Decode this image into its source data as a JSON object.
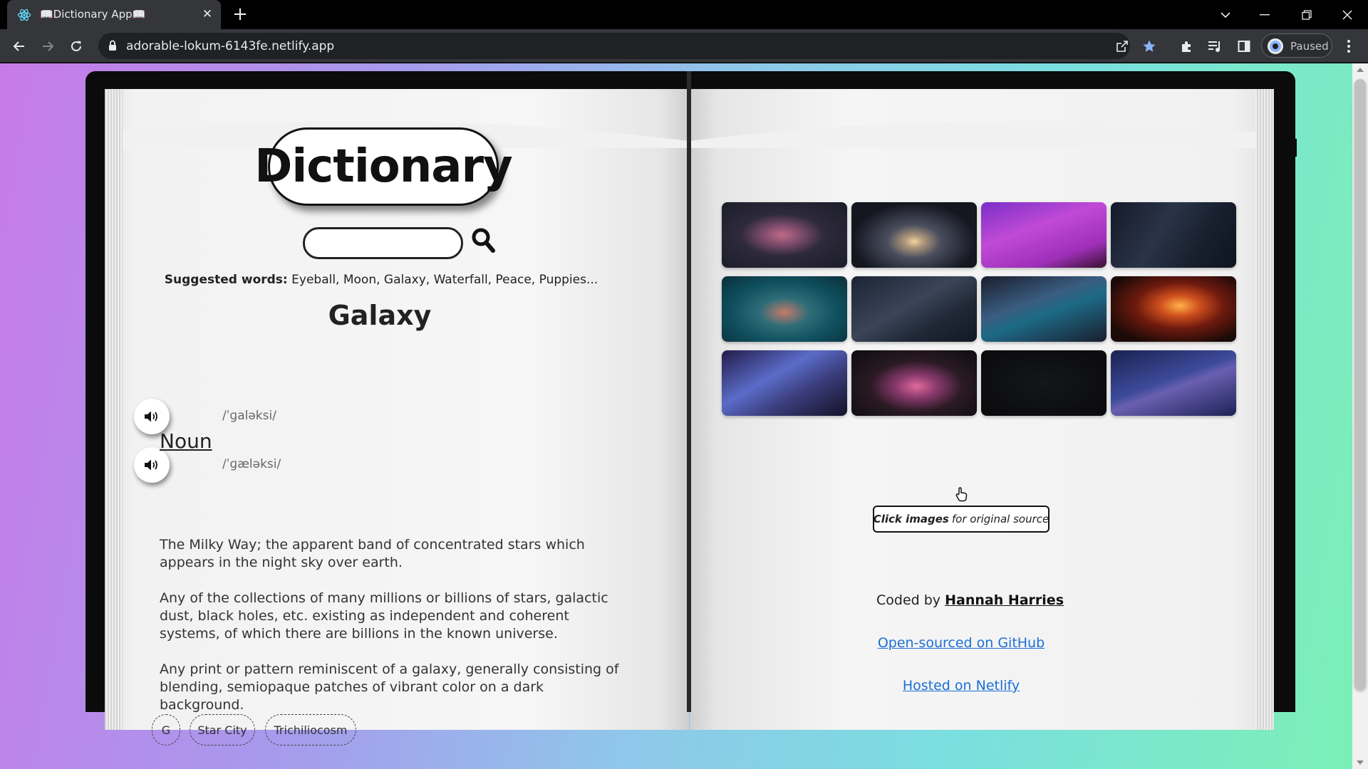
{
  "browser": {
    "tab_title": "📖Dictionary App📖",
    "url": "adorable-lokum-6143fe.netlify.app",
    "profile_status": "Paused"
  },
  "header": {
    "title": "Dictionary",
    "search": {
      "value": "",
      "placeholder": ""
    },
    "suggest_label": "Suggested words:",
    "suggest_words": "Eyeball, Moon, Galaxy, Waterfall, Peace, Puppies..."
  },
  "entry": {
    "word": "Galaxy",
    "phonetics": [
      "/ˈɡaləksi/",
      "/ˈɡæləksi/"
    ],
    "part_of_speech": "Noun",
    "definitions": [
      "The Milky Way; the apparent band of concentrated stars which appears in the night sky over earth.",
      "Any of the collections of many millions or billions of stars, galactic dust, black holes, etc. existing as independent and coherent systems, of which there are billions in the known universe.",
      "Any print or pattern reminiscent of a galaxy, generally consisting of blending, semiopaque patches of vibrant color on a dark background."
    ],
    "synonyms": [
      "G",
      "Star City",
      "Trichiliocosm"
    ]
  },
  "gallery": {
    "hint_bold": "Click images",
    "hint_rest": "for original source"
  },
  "footer": {
    "coded_by": "Coded by",
    "author": "Hannah Harries",
    "github": "Open-sourced on GitHub",
    "netlify": "Hosted on Netlify"
  },
  "colors": {
    "link": "#1a6fd6",
    "chrome_dark": "#35363a",
    "bookmark_star": "#8ab4f8"
  }
}
